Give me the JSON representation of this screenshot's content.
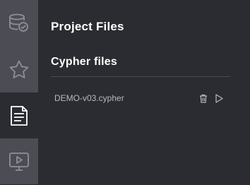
{
  "sidebar": {
    "items": [
      {
        "name": "database-icon",
        "active": false
      },
      {
        "name": "star-icon",
        "active": false
      },
      {
        "name": "document-icon",
        "active": true
      },
      {
        "name": "monitor-play-icon",
        "active": false
      }
    ]
  },
  "panel": {
    "title": "Project Files",
    "section_title": "Cypher files",
    "files": [
      {
        "name": "DEMO-v03.cypher",
        "actions": [
          "trash-icon",
          "play-icon"
        ]
      }
    ]
  },
  "colors": {
    "background": "#2b2c31",
    "sidebar": "#4b4c54",
    "icon": "#9a9ba3",
    "icon_active": "#ffffff",
    "text_primary": "#ffffff",
    "text_secondary": "#b8b9bf"
  }
}
